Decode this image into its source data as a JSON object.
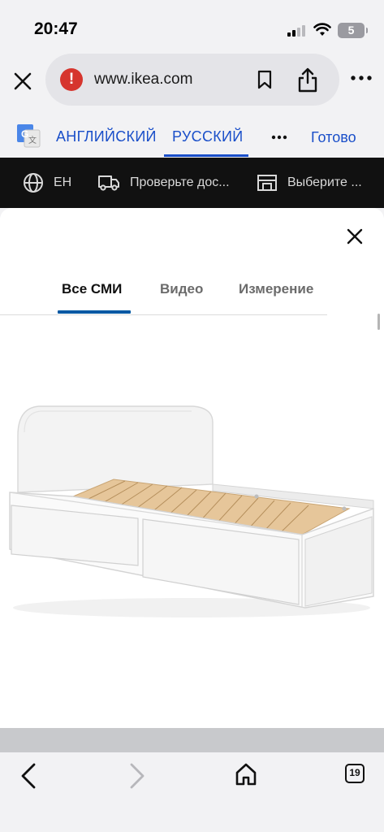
{
  "status_bar": {
    "time": "20:47",
    "battery": "5"
  },
  "browser": {
    "url": "www.ikea.com"
  },
  "translate": {
    "source_lang": "АНГЛИЙСКИЙ",
    "target_lang": "РУССКИЙ",
    "done": "Готово"
  },
  "ikea_bar": {
    "language": "EH",
    "delivery": "Проверьте дос...",
    "store": "Выберите ..."
  },
  "media_sheet": {
    "tabs": [
      "Все СМИ",
      "Видео",
      "Измерение"
    ],
    "active_tab": "Все СМИ"
  },
  "toolbar": {
    "tab_count": "19"
  },
  "colors": {
    "link_blue": "#1a4fc9",
    "ikea_blue": "#0058a3",
    "dark_bar": "#111111",
    "warning_red": "#d6352e"
  }
}
